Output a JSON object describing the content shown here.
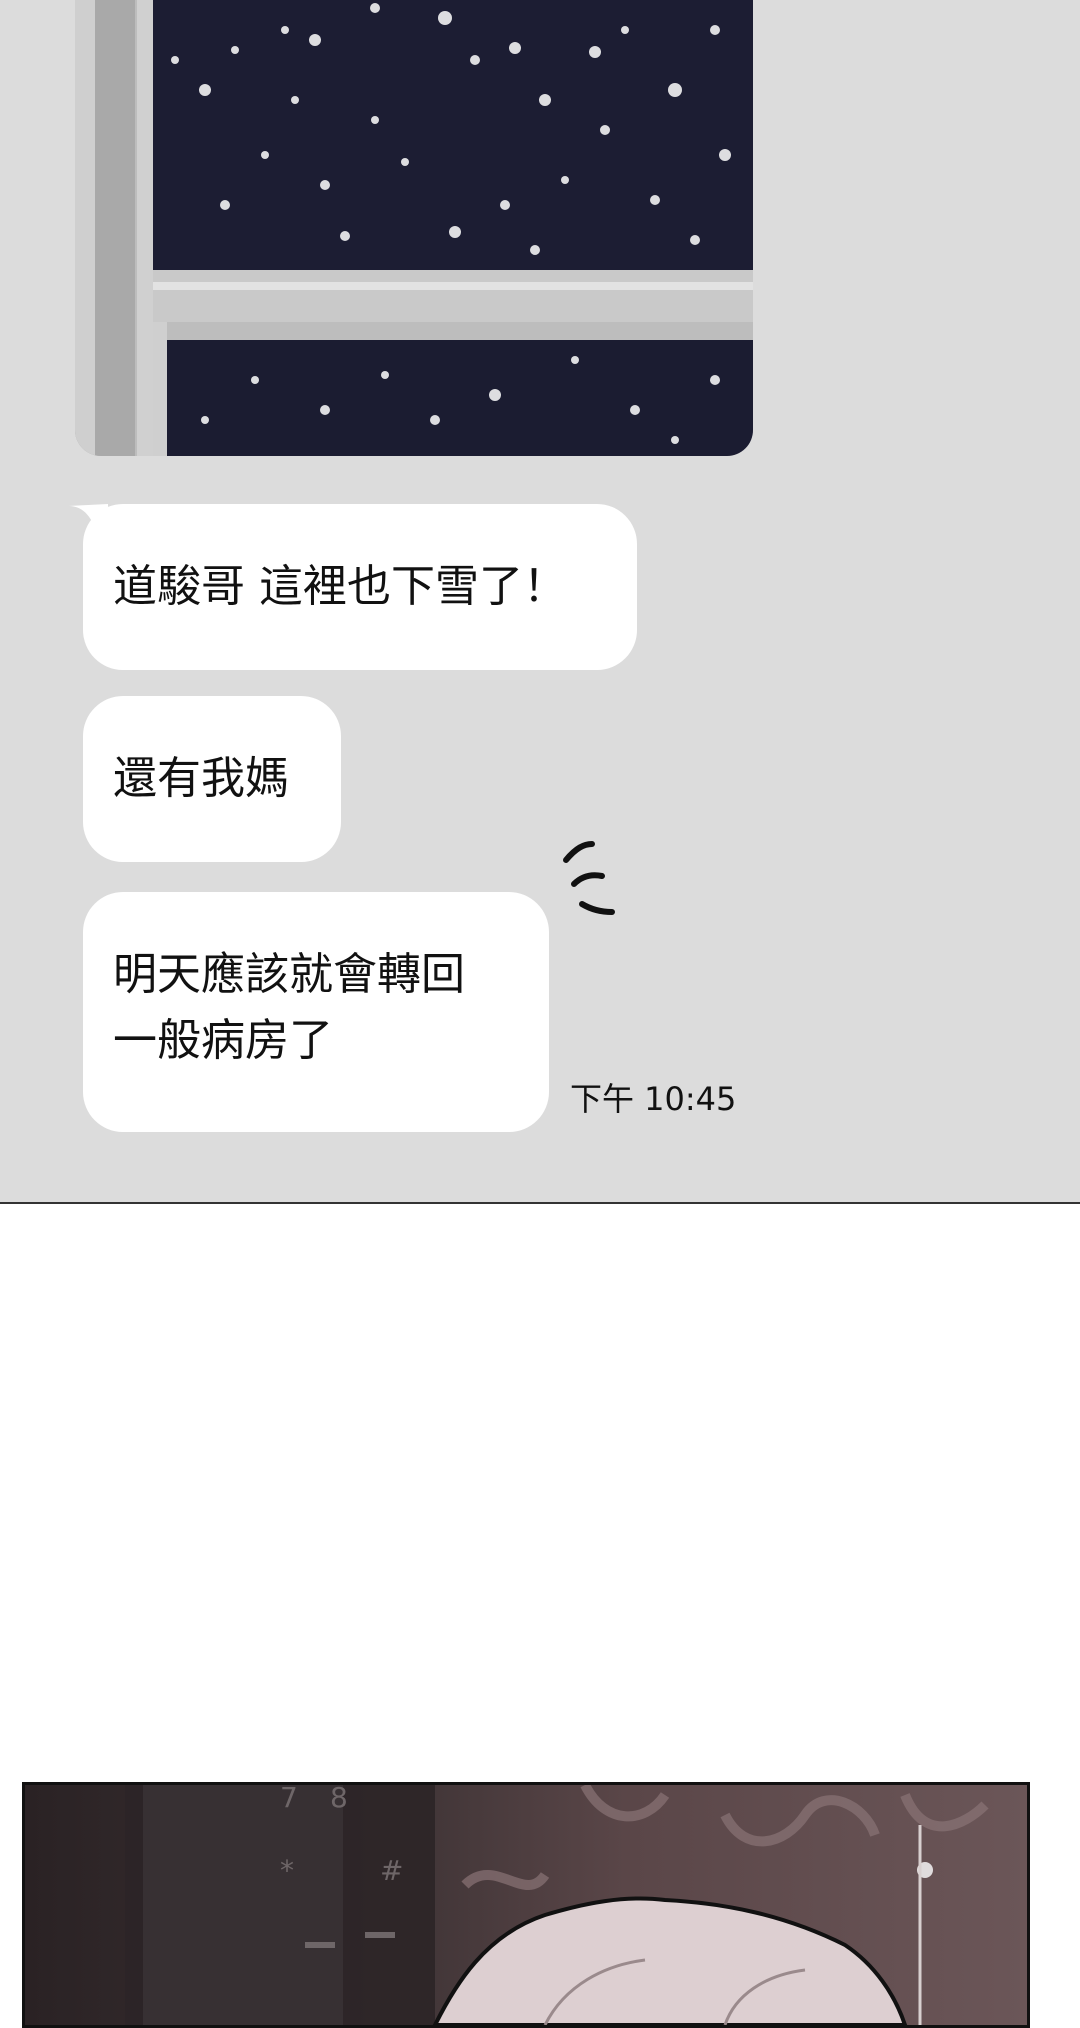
{
  "chat": {
    "messages": [
      {
        "text": "道駿哥 這裡也下雪了！"
      },
      {
        "text": "還有我媽"
      },
      {
        "lines": [
          "明天應該就會轉回",
          "一般病房了"
        ]
      }
    ],
    "timestamp": "下午 10:45"
  },
  "photo": {
    "icon": "snowy-window-photo"
  },
  "sfx": {
    "icon": "vibration-lines-icon"
  },
  "bottom_panel": {
    "keypad_digits": [
      "7",
      "8",
      "*",
      "#"
    ]
  }
}
